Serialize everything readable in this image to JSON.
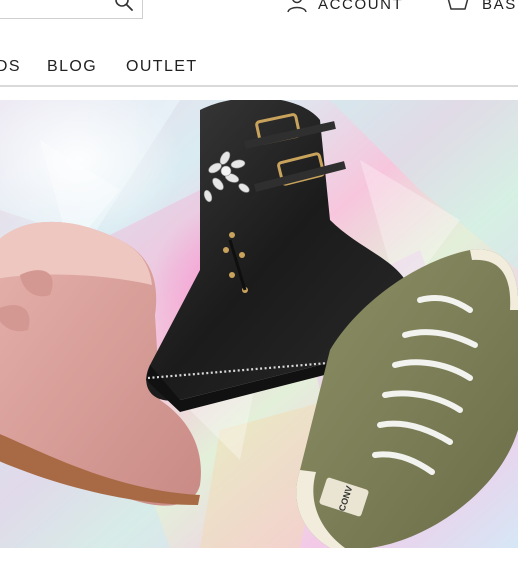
{
  "header": {
    "search": {
      "icon": "search-icon"
    },
    "account": {
      "label": "ACCOUNT",
      "icon": "user-icon"
    },
    "basket": {
      "label": "BASKET",
      "icon": "basket-icon"
    }
  },
  "nav": {
    "items": [
      {
        "label": "KIDS"
      },
      {
        "label": "BLOG"
      },
      {
        "label": "OUTLET"
      }
    ]
  },
  "hero": {
    "description": "promotional-banner-boots-and-sneakers",
    "brand_text_on_shoe": "CONV",
    "colors": {
      "pink_boot": "#dca19a",
      "black_boot": "#222222",
      "green_sneaker": "#7d7f55",
      "background_holo": "#e9d8ef"
    }
  }
}
